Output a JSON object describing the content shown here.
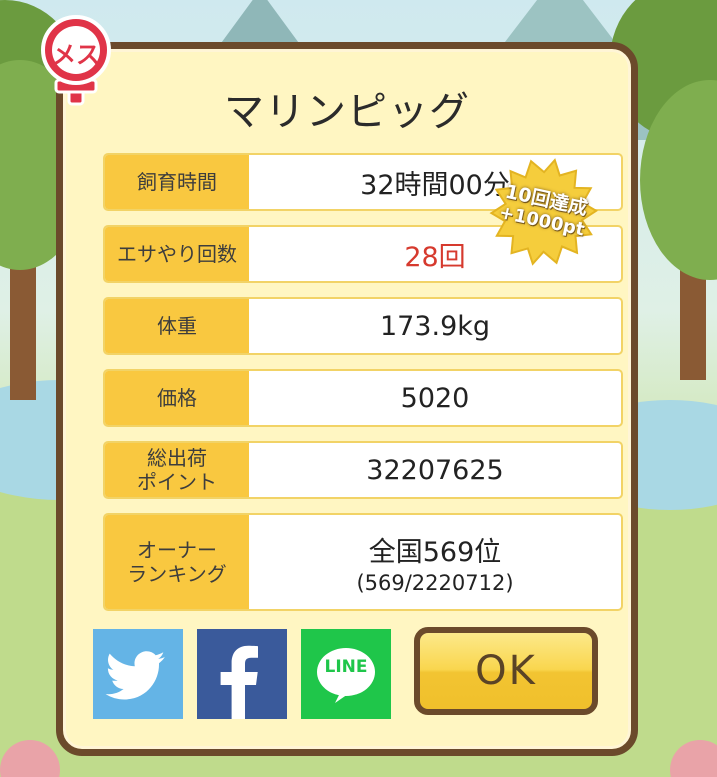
{
  "title": "マリンピッグ",
  "gender_badge": "メス",
  "rows": [
    {
      "label": "飼育時間",
      "value": "32時間00分"
    },
    {
      "label": "エサやり回数",
      "value": "28回"
    },
    {
      "label": "体重",
      "value": "173.9kg"
    },
    {
      "label": "価格",
      "value": "5020"
    },
    {
      "label": "総出荷\nポイント",
      "value": "32207625"
    },
    {
      "label": "オーナー\nランキング",
      "value": "全国569位",
      "sub": "(569/2220712)"
    }
  ],
  "achievement_badge": {
    "line1": "10回達成",
    "line2": "+1000pt"
  },
  "share": {
    "twitter_icon": "twitter-bird-icon",
    "facebook_icon": "facebook-f-icon",
    "line_label": "LINE"
  },
  "ok_label": "OK",
  "colors": {
    "card_border": "#6b4a2b",
    "card_bg": "#fff6c2",
    "label_bg": "#f9c840",
    "highlight_value": "#d63a2e",
    "twitter": "#64b4e6",
    "facebook": "#3a5a9b",
    "line": "#1fc64a",
    "female_symbol": "#e03448"
  }
}
